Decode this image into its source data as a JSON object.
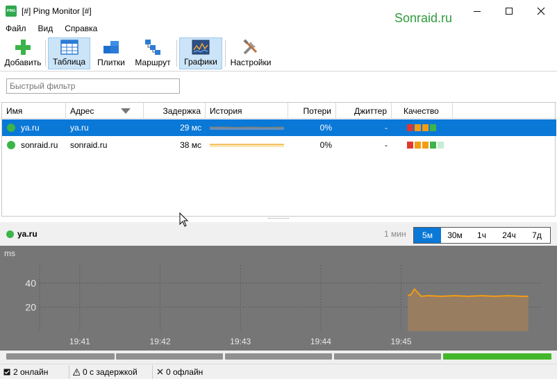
{
  "window": {
    "title": "[#] Ping Monitor [#]",
    "app_icon_text": "PING",
    "brand": "Sonraid.ru"
  },
  "menu": [
    "Файл",
    "Вид",
    "Справка"
  ],
  "toolbar": {
    "add": "Добавить",
    "table": "Таблица",
    "tiles": "Плитки",
    "route": "Маршрут",
    "graphs": "Графики",
    "settings": "Настройки",
    "active_views": [
      "Таблица",
      "Графики"
    ]
  },
  "filter": {
    "placeholder": "Быстрый фильтр",
    "value": ""
  },
  "table": {
    "columns": [
      "Имя",
      "Адрес",
      "Задержка",
      "История",
      "Потери",
      "Джиттер",
      "Качество"
    ],
    "rows": [
      {
        "name": "ya.ru",
        "address": "ya.ru",
        "latency": "29 мс",
        "loss": "0%",
        "jitter": "-",
        "status_color": "#3cb44a",
        "selected": true,
        "quality": [
          "#e0382f",
          "#f39c12",
          "#f39c12",
          "#3cb44a"
        ]
      },
      {
        "name": "sonraid.ru",
        "address": "sonraid.ru",
        "latency": "38 мс",
        "loss": "0%",
        "jitter": "-",
        "status_color": "#3cb44a",
        "selected": false,
        "quality": [
          "#e0382f",
          "#f39c12",
          "#f39c12",
          "#3cb44a",
          "#c8ecd4"
        ]
      }
    ]
  },
  "detail": {
    "host": "ya.ru",
    "range_label": "1 мин",
    "ranges": [
      "5м",
      "30м",
      "1ч",
      "24ч",
      "7д"
    ],
    "active_range": "5м"
  },
  "chart_data": {
    "type": "area",
    "ylabel": "ms",
    "y_ticks": [
      20,
      40
    ],
    "x_ticks": [
      "19:41",
      "19:42",
      "19:43",
      "19:44",
      "19:45"
    ],
    "grid": true,
    "series": [
      {
        "color": "#f39c12",
        "x": [
          "19:45:05",
          "19:45:07",
          "19:45:10",
          "19:45:15",
          "19:45:20",
          "19:45:30",
          "19:45:40",
          "19:45:50",
          "19:46:00",
          "19:46:10",
          "19:46:20",
          "19:46:30",
          "19:46:35"
        ],
        "y": [
          30,
          30,
          35,
          29,
          29.5,
          29,
          29.5,
          29,
          29.5,
          29,
          29.5,
          29,
          29
        ]
      }
    ]
  },
  "status": {
    "online": "2 онлайн",
    "delayed": "0 с задержкой",
    "offline": "0 офлайн"
  }
}
